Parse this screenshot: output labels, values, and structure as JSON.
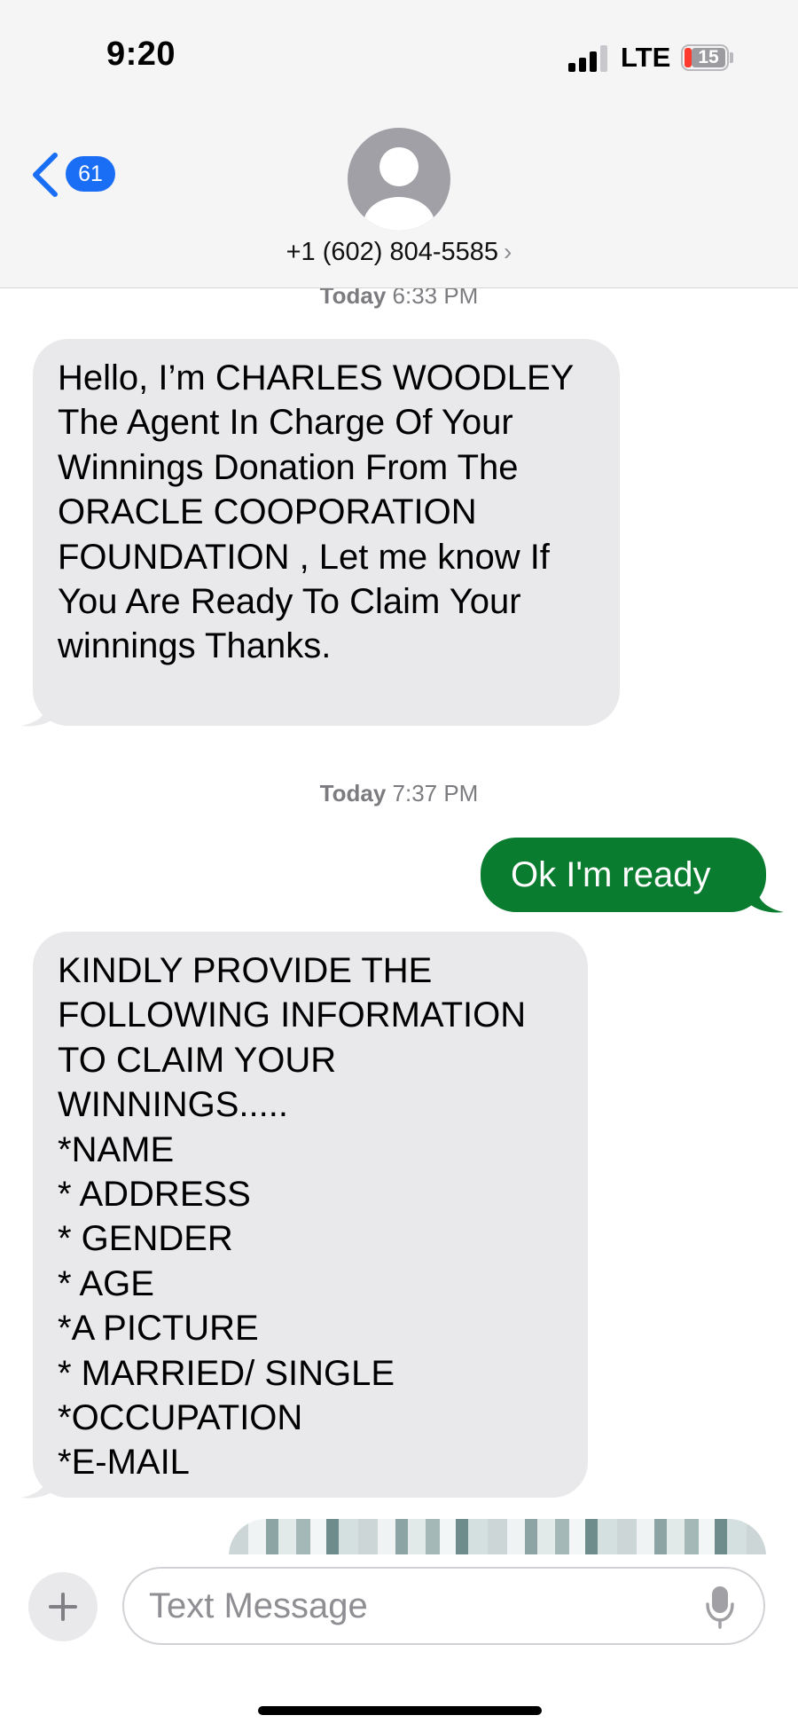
{
  "status_bar": {
    "time": "9:20",
    "network": "LTE",
    "battery": "15",
    "battery_color": "#ff3b30"
  },
  "header": {
    "back_badge": "61",
    "contact": "+1 (602) 804-5585",
    "chevron": "›",
    "avatar_icon": "person-silhouette-icon"
  },
  "messages": [
    {
      "type": "timestamp",
      "day": "Today",
      "time": "6:33 PM"
    },
    {
      "type": "incoming",
      "text": "Hello, I’m CHARLES WOODLEY The Agent In Charge  Of Your  Winnings Donation  From  The ORACLE COOPORATION FOUNDATION , Let me know If You Are Ready To Claim Your winnings Thanks."
    },
    {
      "type": "timestamp",
      "day": "Today",
      "time": "7:37 PM"
    },
    {
      "type": "outgoing",
      "text": "Ok I'm ready"
    },
    {
      "type": "incoming",
      "text": "KINDLY PROVIDE THE FOLLOWING INFORMATION TO CLAIM YOUR WINNINGS.....\n*NAME\n* ADDRESS\n* GENDER\n* AGE\n*A PICTURE\n* MARRIED/ SINGLE\n*OCCUPATION\n*E-MAIL"
    }
  ],
  "colors": {
    "outgoing_bubble": "#0a7c2f",
    "incoming_bubble": "#e9e9eb",
    "badge": "#1a6ef5"
  },
  "input": {
    "placeholder": "Text Message",
    "value": ""
  }
}
